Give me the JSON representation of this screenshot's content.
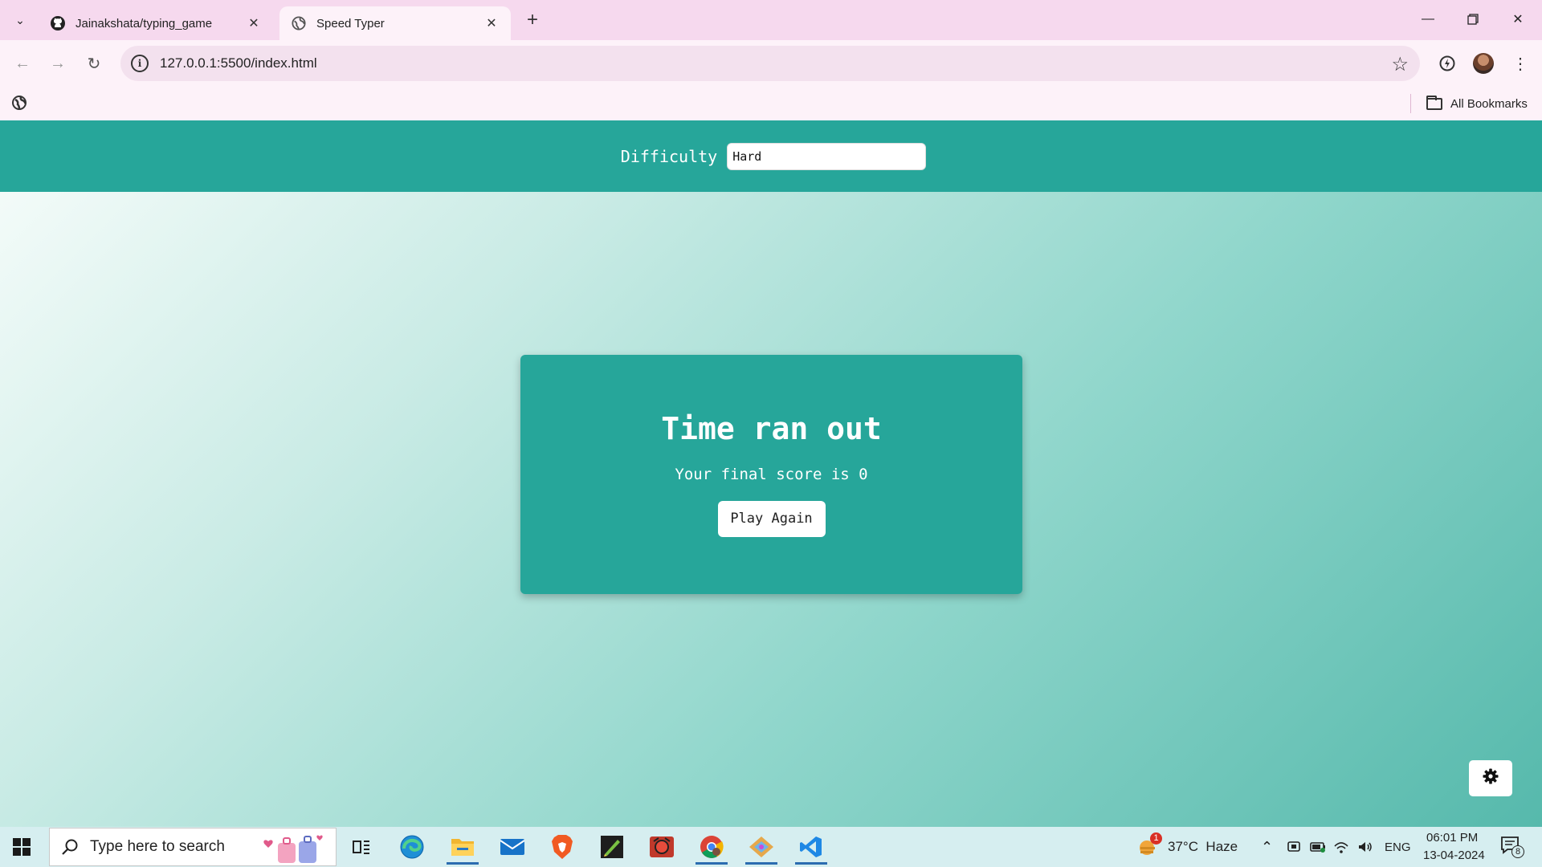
{
  "browser": {
    "tabs": [
      {
        "title": "Jainakshata/typing_game",
        "icon": "github-icon",
        "active": false
      },
      {
        "title": "Speed Typer",
        "icon": "globe-icon",
        "active": true
      }
    ],
    "url": "127.0.0.1:5500/index.html",
    "bookmarks_label": "All Bookmarks"
  },
  "game": {
    "difficulty_label": "Difficulty",
    "difficulty_value": "Hard",
    "card_title": "Time ran out",
    "card_score_text": "Your final score is 0",
    "play_again_label": "Play Again",
    "settings_icon": "gear-icon"
  },
  "taskbar": {
    "search_placeholder": "Type here to search",
    "weather": "37°C  Haze",
    "weather_badge": "1",
    "language": "ENG",
    "time": "06:01 PM",
    "date": "13-04-2024",
    "notification_count": "8"
  },
  "colors": {
    "accent": "#26a69a",
    "tabbar": "#f6d9ee",
    "toolbar": "#fdf2f9"
  }
}
